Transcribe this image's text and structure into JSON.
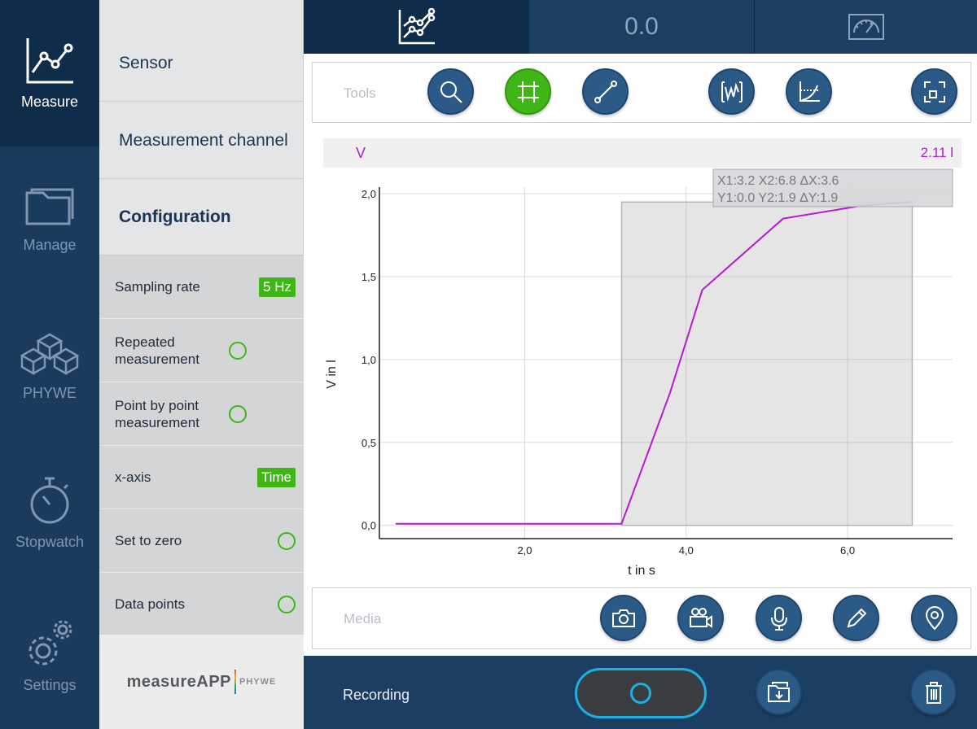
{
  "nav": {
    "items": [
      {
        "label": "Measure",
        "icon": "chart-line-icon",
        "active": true
      },
      {
        "label": "Manage",
        "icon": "folder-icon"
      },
      {
        "label": "PHYWE",
        "icon": "cubes-icon"
      },
      {
        "label": "Stopwatch",
        "icon": "stopwatch-icon"
      },
      {
        "label": "Settings",
        "icon": "gears-icon"
      }
    ]
  },
  "config": {
    "sensor": "Sensor",
    "channel": "Measurement channel",
    "configuration": "Configuration",
    "rows": [
      {
        "label": "Sampling rate",
        "badge": "5 Hz"
      },
      {
        "label": "Repeated measurement",
        "toggle": "off"
      },
      {
        "label": "Point by point measurement",
        "toggle": "off"
      },
      {
        "label": "x-axis",
        "badge": "Time"
      },
      {
        "label": "Set to zero",
        "toggle": "off"
      },
      {
        "label": "Data points",
        "toggle": "off"
      }
    ],
    "logo": {
      "name": "measureAPP",
      "brand": "PHYWE"
    }
  },
  "topbar": {
    "tabs": [
      {
        "icon": "chart-line-icon",
        "active": true
      },
      {
        "value": "0.0"
      },
      {
        "icon": "gauge-icon"
      }
    ]
  },
  "tools": {
    "label": "Tools",
    "buttons": [
      "zoom-icon",
      "crop-select-icon",
      "line-draw-icon",
      "signal-icon",
      "curve-fit-icon",
      "fullscreen-icon"
    ],
    "active": "crop-select-icon"
  },
  "series": {
    "name": "V",
    "current_value": "2.11 l",
    "color": "#b31ccf"
  },
  "chart_data": {
    "type": "line",
    "xlabel": "t in s",
    "ylabel": "V in l",
    "xlim": [
      0.2,
      7.3
    ],
    "ylim": [
      -0.08,
      2.04
    ],
    "x_ticks": [
      "2,0",
      "4,0",
      "6,0"
    ],
    "x_tick_values": [
      2,
      4,
      6
    ],
    "y_ticks": [
      "0,0",
      "0,5",
      "1,0",
      "1,5",
      "2,0"
    ],
    "y_tick_values": [
      0,
      0.5,
      1.0,
      1.5,
      2.0
    ],
    "series": [
      {
        "x": [
          0.4,
          3.2,
          3.8,
          4.2,
          5.2,
          6.2,
          6.8
        ],
        "y": [
          0.01,
          0.01,
          0.8,
          1.42,
          1.85,
          1.93,
          1.95
        ]
      }
    ],
    "selection": {
      "x1": 3.2,
      "x2": 6.8,
      "y1": 0.0,
      "y2": 1.95
    },
    "readout": {
      "line1": "X1:3.2  X2:6.8  ΔX:3.6",
      "line2": "Y1:0.0  Y2:1.9  ΔY:1.9"
    }
  },
  "media": {
    "label": "Media",
    "buttons": [
      "camera-icon",
      "video-camera-icon",
      "microphone-icon",
      "pencil-icon",
      "location-pin-icon"
    ]
  },
  "bottombar": {
    "recording_label": "Recording",
    "buttons": [
      "record-button",
      "save-folder-icon",
      "trash-icon"
    ]
  }
}
